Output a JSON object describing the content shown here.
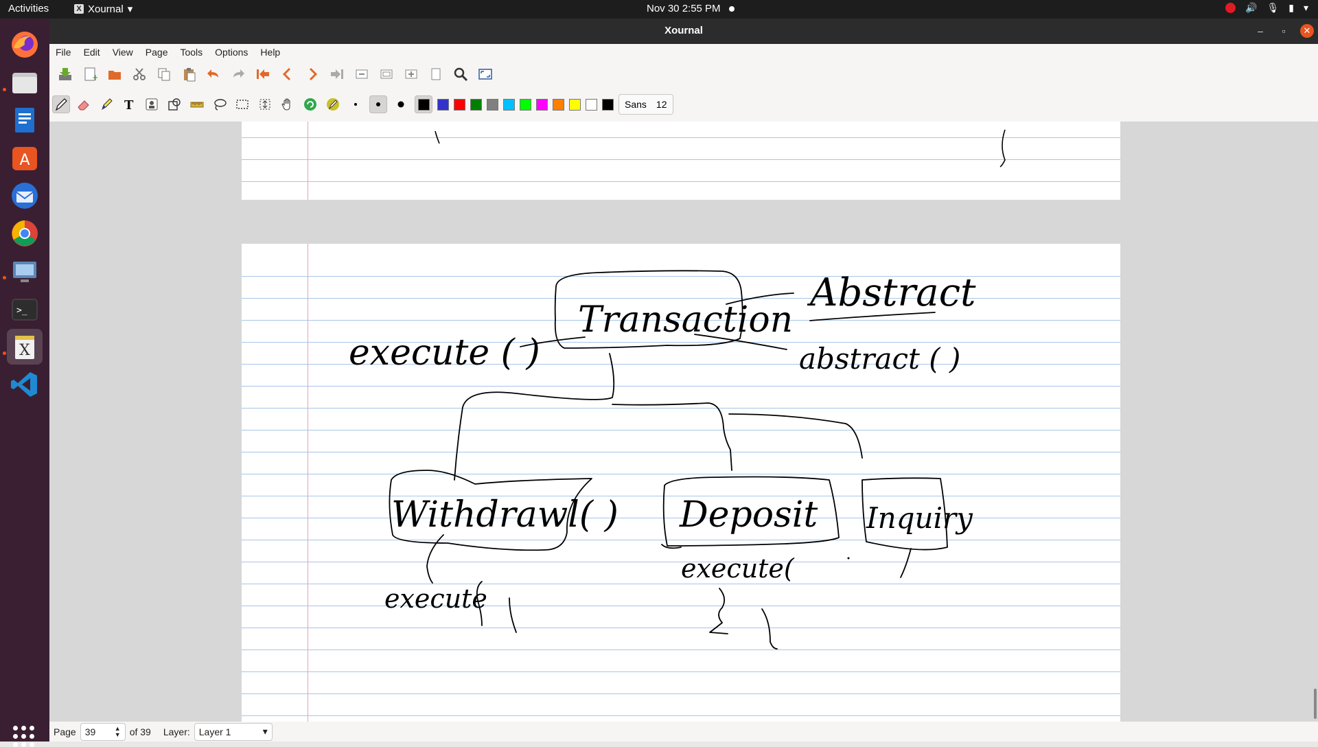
{
  "topbar": {
    "activities": "Activities",
    "app_name": "Xournal",
    "clock": "Nov 30  2:55 PM"
  },
  "window": {
    "title": "Xournal"
  },
  "menu": [
    "File",
    "Edit",
    "View",
    "Page",
    "Tools",
    "Options",
    "Help"
  ],
  "toolbar": {
    "font_name": "Sans",
    "font_size": "12",
    "colors": [
      "#000000",
      "#3333cc",
      "#ff0000",
      "#008000",
      "#808080",
      "#00c0ff",
      "#00ff00",
      "#ff00ff",
      "#ff8000",
      "#ffff00",
      "#ffffff",
      "#000000"
    ]
  },
  "drawing_words": {
    "transaction": "Transaction",
    "abstract_top": "Abstract",
    "abstract_method": "abstract ( )",
    "execute": "execute ( )",
    "withdrawl": "Withdrawl( )",
    "deposit": "Deposit",
    "enquiry": "Inquiry",
    "execute_lower": "execute(",
    "execute_left": "execute"
  },
  "statusbar": {
    "page_label": "Page",
    "page_value": "39",
    "of_label": "of 39",
    "layer_label": "Layer:",
    "layer_value": "Layer 1"
  }
}
